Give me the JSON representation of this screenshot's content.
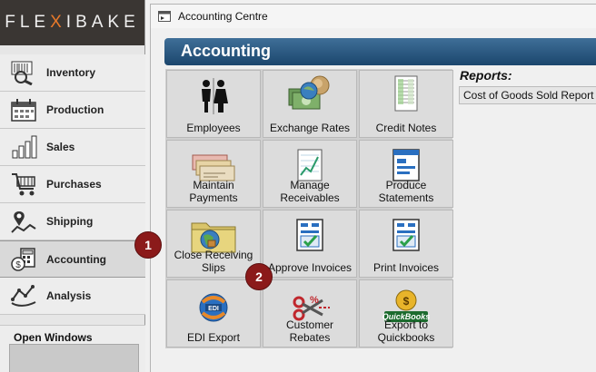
{
  "logo": {
    "part1": "FLE",
    "x": "X",
    "part2": "I",
    "part3": "BAKE"
  },
  "sidebar": {
    "items": [
      {
        "label": "Inventory",
        "icon": "inventory-icon"
      },
      {
        "label": "Production",
        "icon": "production-icon"
      },
      {
        "label": "Sales",
        "icon": "sales-icon"
      },
      {
        "label": "Purchases",
        "icon": "purchases-icon"
      },
      {
        "label": "Shipping",
        "icon": "shipping-icon"
      },
      {
        "label": "Accounting",
        "icon": "accounting-icon",
        "active": true
      },
      {
        "label": "Analysis",
        "icon": "analysis-icon"
      }
    ],
    "open_windows_title": "Open Windows"
  },
  "window": {
    "title": "Accounting Centre",
    "header": "Accounting"
  },
  "tiles": [
    {
      "label": "Employees",
      "icon": "employees-icon"
    },
    {
      "label": "Exchange Rates",
      "icon": "exchange-rates-icon"
    },
    {
      "label": "Credit Notes",
      "icon": "credit-notes-icon"
    },
    {
      "label": "Maintain\nPayments",
      "icon": "payments-icon"
    },
    {
      "label": "Manage\nReceivables",
      "icon": "receivables-icon"
    },
    {
      "label": "Produce\nStatements",
      "icon": "statements-icon"
    },
    {
      "label": "Close Receiving\nSlips",
      "icon": "folder-icon"
    },
    {
      "label": "Approve Invoices",
      "icon": "approve-invoices-icon"
    },
    {
      "label": "Print Invoices",
      "icon": "print-invoices-icon"
    },
    {
      "label": "EDI Export",
      "icon": "edi-icon"
    },
    {
      "label": "Customer\nRebates",
      "icon": "rebates-icon"
    },
    {
      "label": "Export to\nQuickbooks",
      "icon": "quickbooks-icon"
    }
  ],
  "reports": {
    "title": "Reports:",
    "items": [
      "Cost of Goods Sold Report"
    ]
  },
  "callouts": [
    "1",
    "2"
  ],
  "colors": {
    "header_bg": "#1b466d",
    "callout": "#8b1a1a",
    "logo_bg": "#3a3633",
    "logo_accent": "#e8792a"
  }
}
